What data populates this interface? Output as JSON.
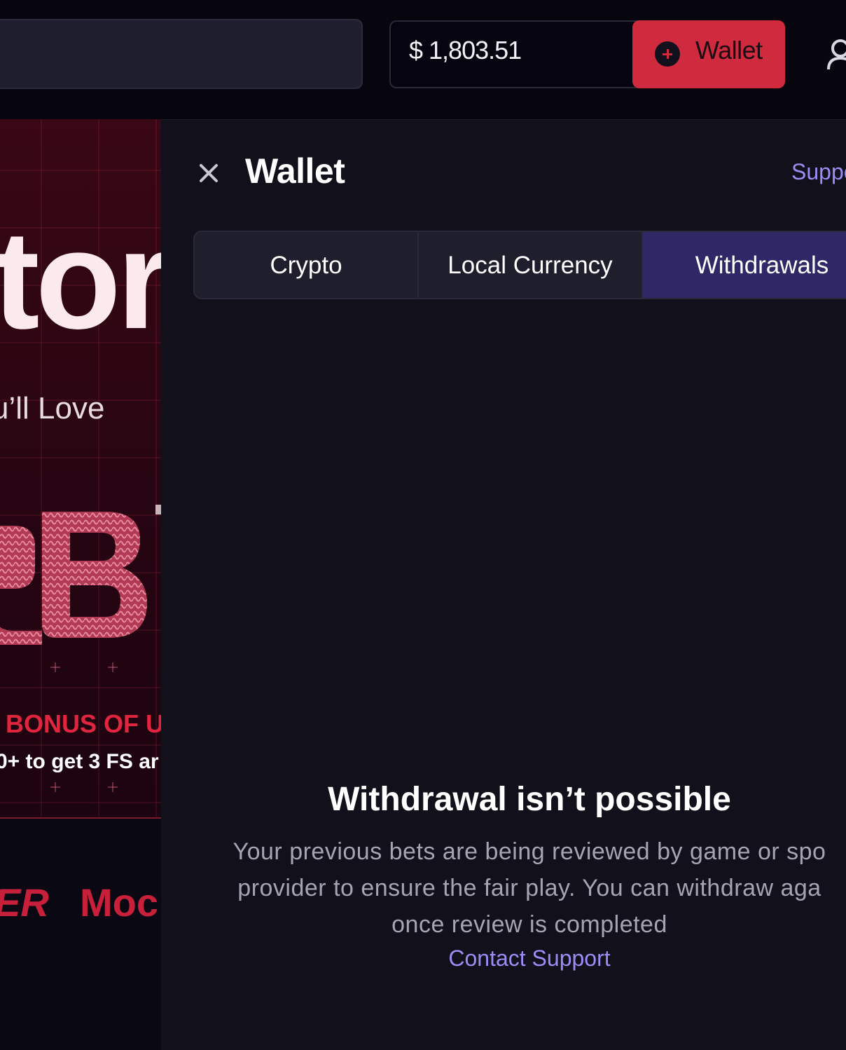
{
  "header": {
    "balance": "$ 1,803.51",
    "wallet_button": "Wallet"
  },
  "promo": {
    "headline": "tor",
    "tagline": "u’ll Love",
    "bonus": "BONUS OF UP",
    "bonus_detail": "0+ to get 3 FS ar",
    "brand_1": "ER",
    "brand_2": "Moc"
  },
  "wallet_panel": {
    "title": "Wallet",
    "support_link": "Suppo",
    "tabs": [
      {
        "label": "Crypto",
        "active": false
      },
      {
        "label": "Local Currency",
        "active": false
      },
      {
        "label": "Withdrawals",
        "active": true
      }
    ],
    "message": {
      "title": "Withdrawal isn’t possible",
      "body_lines": [
        "Your previous bets are being reviewed by game or spo",
        "provider to ensure the fair play. You can withdraw aga",
        "once review is completed"
      ],
      "contact_link": "Contact Support"
    }
  },
  "colors": {
    "accent_red": "#cf2a3e",
    "link_purple": "#9a8ef6",
    "active_tab": "#2e2966",
    "panel_bg": "#11101b"
  }
}
